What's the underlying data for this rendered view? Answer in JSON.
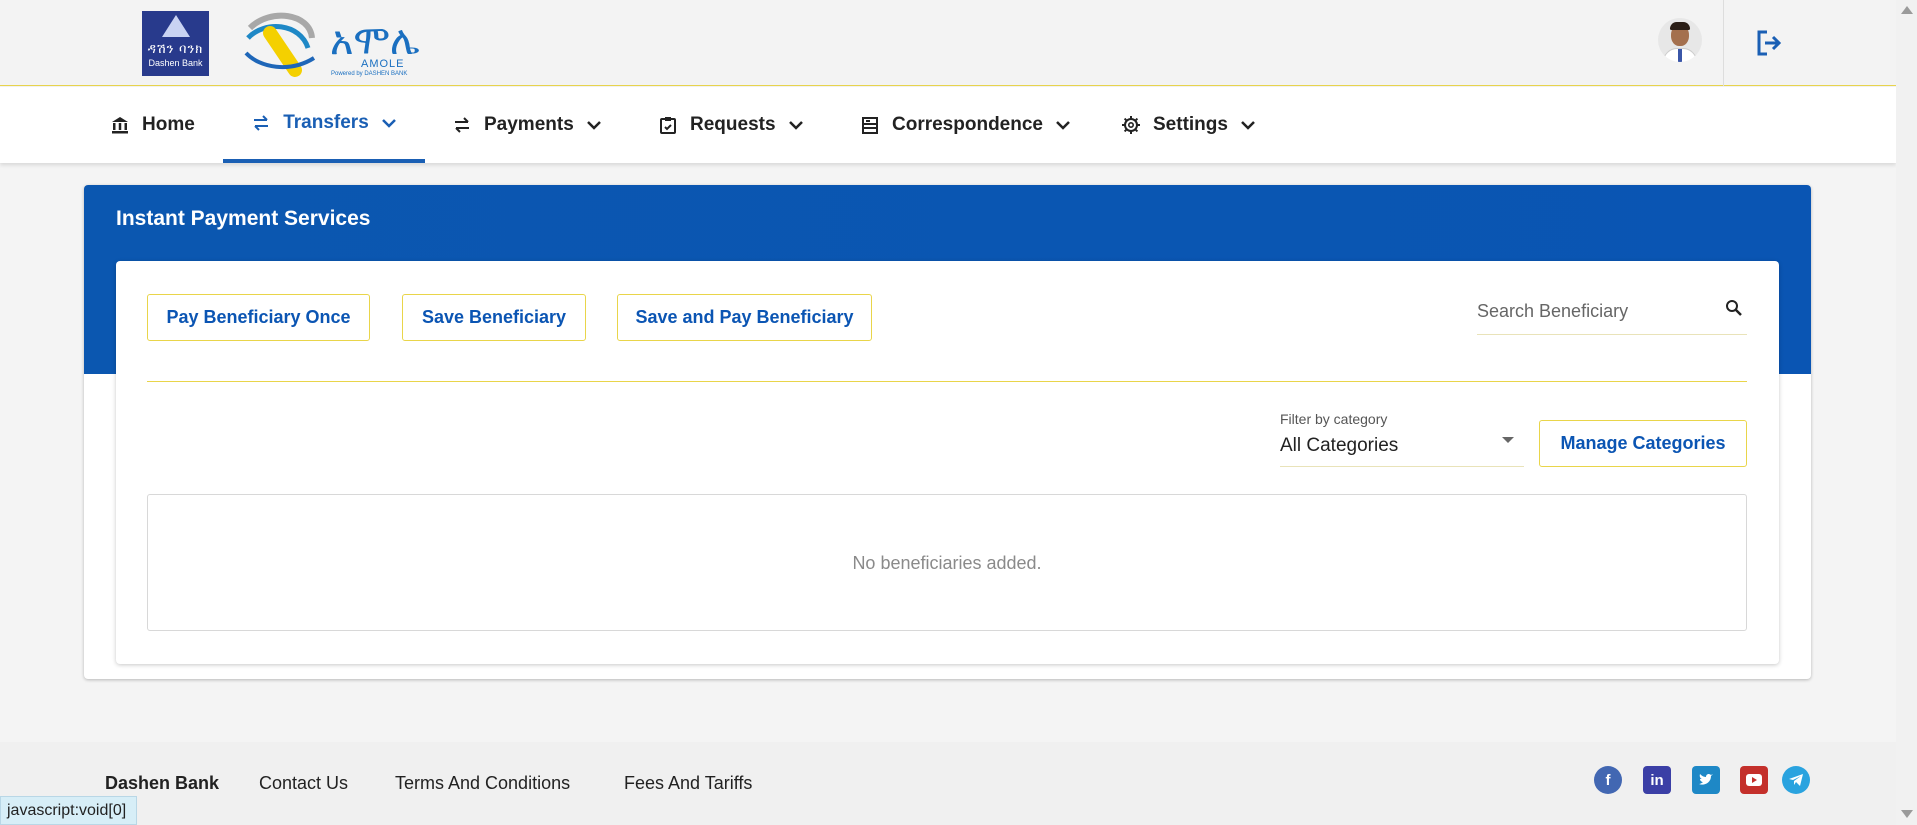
{
  "header": {
    "dashen_logo": {
      "amharic": "ዳሽን ባንክ",
      "english": "Dashen Bank"
    },
    "amole_logo": {
      "amharic": "አሞሌ",
      "english": "AMOLE",
      "powered_by": "Powered by DASHEN BANK"
    },
    "avatar_icon": "user-avatar",
    "logout_icon": "logout-icon"
  },
  "nav": {
    "items": [
      {
        "label": "Home",
        "icon": "bank-icon",
        "active": false,
        "dropdown": false
      },
      {
        "label": "Transfers",
        "icon": "swap-arrows-icon",
        "active": true,
        "dropdown": true
      },
      {
        "label": "Payments",
        "icon": "swap-arrows-icon",
        "active": false,
        "dropdown": true
      },
      {
        "label": "Requests",
        "icon": "clipboard-icon",
        "active": false,
        "dropdown": true
      },
      {
        "label": "Correspondence",
        "icon": "mailbox-icon",
        "active": false,
        "dropdown": true
      },
      {
        "label": "Settings",
        "icon": "gear-icon",
        "active": false,
        "dropdown": true
      }
    ],
    "active_color": "#1a5fb4"
  },
  "page": {
    "title": "Instant Payment Services",
    "band_color": "#0b57b0",
    "actions": {
      "pay_once": "Pay Beneficiary Once",
      "save": "Save Beneficiary",
      "save_and_pay": "Save and Pay Beneficiary"
    },
    "search": {
      "placeholder": "Search Beneficiary",
      "value": ""
    },
    "filter": {
      "label": "Filter by category",
      "value": "All Categories"
    },
    "manage_categories": "Manage Categories",
    "empty_message": "No beneficiaries added."
  },
  "footer": {
    "brand": "Dashen Bank",
    "links": [
      "Contact Us",
      "Terms And Conditions",
      "Fees And Tariffs"
    ],
    "social": [
      {
        "name": "facebook-icon",
        "color": "#4267b2"
      },
      {
        "name": "linkedin-icon",
        "color": "#3b3fa6"
      },
      {
        "name": "twitter-icon",
        "color": "#1e88c6"
      },
      {
        "name": "youtube-icon",
        "color": "#c4302b"
      },
      {
        "name": "telegram-icon",
        "color": "#2aa3df"
      }
    ]
  },
  "status_bar": {
    "url": "javascript:void[0]"
  }
}
